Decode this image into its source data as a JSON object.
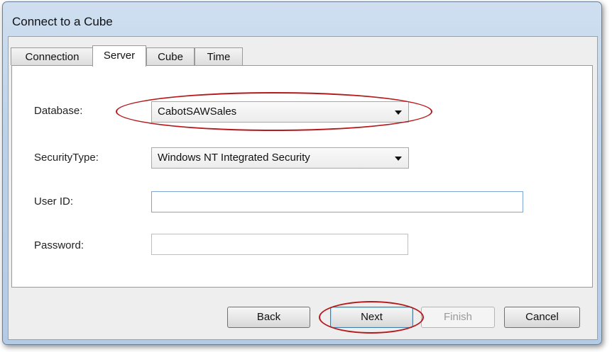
{
  "window": {
    "title": "Connect to a Cube"
  },
  "tabs": [
    {
      "label": "Connection"
    },
    {
      "label": "Server"
    },
    {
      "label": "Cube"
    },
    {
      "label": "Time"
    }
  ],
  "active_tab": "Server",
  "form": {
    "database": {
      "label": "Database:",
      "value": "CabotSAWSales"
    },
    "security_type": {
      "label": "SecurityType:",
      "value": "Windows NT Integrated Security"
    },
    "user_id": {
      "label": "User ID:",
      "value": ""
    },
    "password": {
      "label": "Password:",
      "value": ""
    }
  },
  "buttons": {
    "back": "Back",
    "next": "Next",
    "finish": "Finish",
    "cancel": "Cancel"
  },
  "annotations": {
    "highlight_color": "#b5191b"
  }
}
